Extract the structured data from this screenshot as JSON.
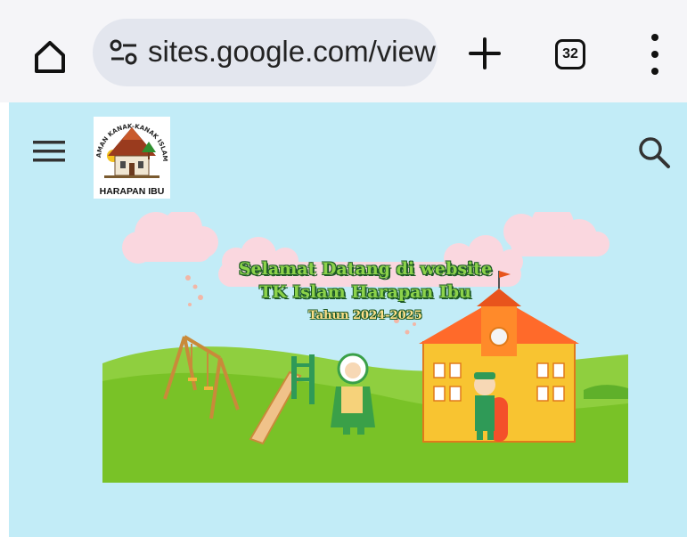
{
  "browser": {
    "url": "sites.google.com/view",
    "tab_count": "32"
  },
  "site": {
    "logo_arc_text": "TAMAN KANAK-KANAK ISLAM",
    "logo_label": "HARAPAN IBU"
  },
  "banner": {
    "line1": "Selamat Datang di website",
    "line2": "TK Islam Harapan Ibu",
    "line3": "Tahun 2024-2025"
  },
  "colors": {
    "page_background": "#c2ecf7",
    "browser_bar": "#f5f5f8",
    "url_pill": "#e3e6ee",
    "banner_title_green": "#8cd24a",
    "grass_green": "#79c227"
  },
  "icons": {
    "home": "home-icon",
    "site_settings": "tune-icon",
    "new_tab": "plus-icon",
    "tabs": "tab-switcher-icon",
    "more": "more-vert-icon",
    "menu": "hamburger-menu-icon",
    "search": "search-icon"
  }
}
